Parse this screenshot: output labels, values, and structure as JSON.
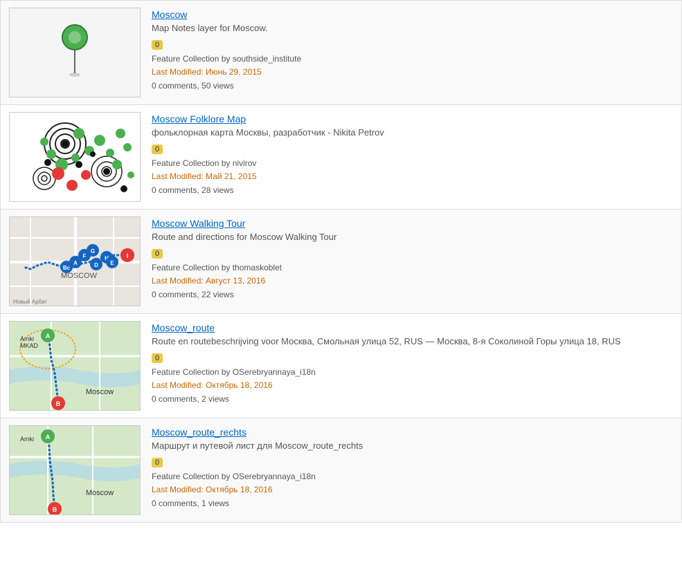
{
  "items": [
    {
      "id": "moscow",
      "title": "Moscow",
      "description": "Map Notes layer for Moscow.",
      "badge": "0",
      "by": "Feature Collection by southside_institute",
      "modified": "Last Modified: Июнь 29, 2015",
      "stats": "0 comments, 50 views",
      "thumbnail_type": "pin"
    },
    {
      "id": "moscow-folklore",
      "title": "Moscow Folklore Map",
      "description": "фольклорная карта Москвы, разработчик - Nikita Petrov",
      "badge": "0",
      "by": "Feature Collection by nivirov",
      "modified": "Last Modified: Май 21, 2015",
      "stats": "0 comments, 28 views",
      "thumbnail_type": "folklore"
    },
    {
      "id": "moscow-walking-tour",
      "title": "Moscow Walking Tour",
      "description": "Route and directions for Moscow Walking Tour",
      "badge": "0",
      "by": "Feature Collection by thomaskoblet",
      "modified": "Last Modified: Август 13, 2016",
      "stats": "0 comments, 22 views",
      "thumbnail_type": "walking"
    },
    {
      "id": "moscow-route",
      "title": "Moscow_route",
      "description": "Route en routebeschrijving voor Москва, Смольная улица 52, RUS — Москва, 8-я Соколиной Горы улица 18, RUS",
      "badge": "0",
      "by": "Feature Collection by OSerebryannaya_i18n",
      "modified": "Last Modified: Октябрь 18, 2016",
      "stats": "0 comments, 2 views",
      "thumbnail_type": "route"
    },
    {
      "id": "moscow-route-rechts",
      "title": "Moscow_route_rechts",
      "description": "Маршрут и путевой лист для Moscow_route_rechts",
      "badge": "0",
      "by": "Feature Collection by OSerebryannaya_i18n",
      "modified": "Last Modified: Октябрь 18, 2016",
      "stats": "0 comments, 1 views",
      "thumbnail_type": "route2"
    }
  ]
}
